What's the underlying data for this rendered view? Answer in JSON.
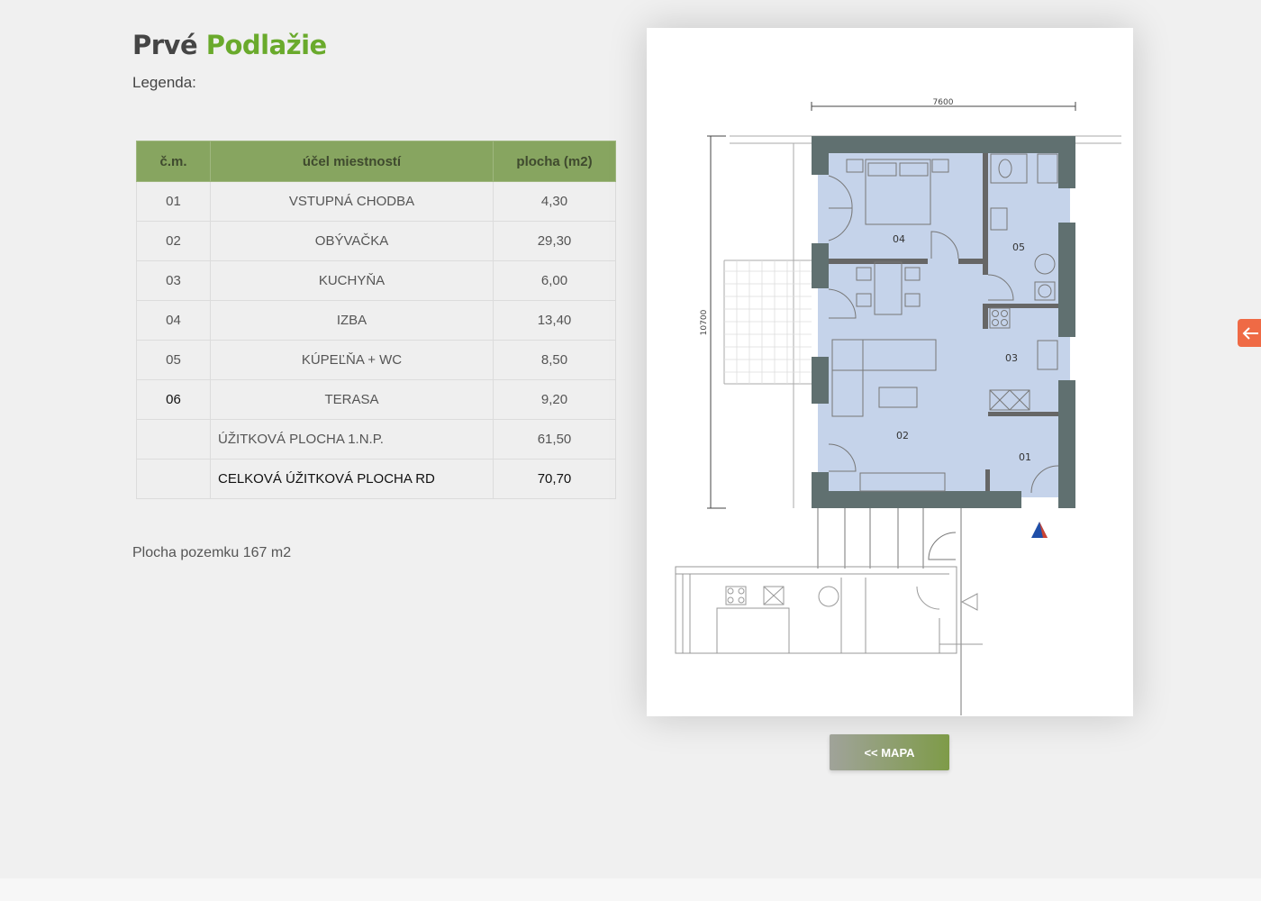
{
  "heading": {
    "part1": "Prvé",
    "part2": "Podlažie"
  },
  "legend_label": "Legenda:",
  "table": {
    "headers": [
      "č.m.",
      "účel miestností",
      "plocha (m2)"
    ],
    "rows": [
      {
        "num": "01",
        "name": "VSTUPNÁ CHODBA",
        "area": "4,30"
      },
      {
        "num": "02",
        "name": "OBÝVAČKA",
        "area": "29,30"
      },
      {
        "num": "03",
        "name": "KUCHYŇA",
        "area": "6,00"
      },
      {
        "num": "04",
        "name": "IZBA",
        "area": "13,40"
      },
      {
        "num": "05",
        "name": "KÚPEĽŇA + WC",
        "area": "8,50"
      },
      {
        "num": "06",
        "name": "TERASA",
        "area": "9,20"
      }
    ],
    "summary": [
      {
        "label": "ÚŽITKOVÁ PLOCHA 1.N.P.",
        "area": "61,50"
      },
      {
        "label": "CELKOVÁ ÚŽITKOVÁ PLOCHA RD",
        "area": "70,70"
      }
    ]
  },
  "plot_area": "Plocha pozemku 167 m2",
  "floorplan": {
    "dim_width": "7600",
    "dim_height": "10700",
    "room_labels": [
      "04",
      "05",
      "03",
      "02",
      "01"
    ]
  },
  "map_button": "<< MAPA",
  "icons": {
    "side_tab": "arrow-left-icon",
    "north_marker": "triangle-marker-icon"
  },
  "colors": {
    "accent_green": "#6aaa2c",
    "table_header": "#87a560",
    "side_tab": "#ef6a45",
    "room_fill": "#c5d3ea",
    "wall": "#607070"
  }
}
